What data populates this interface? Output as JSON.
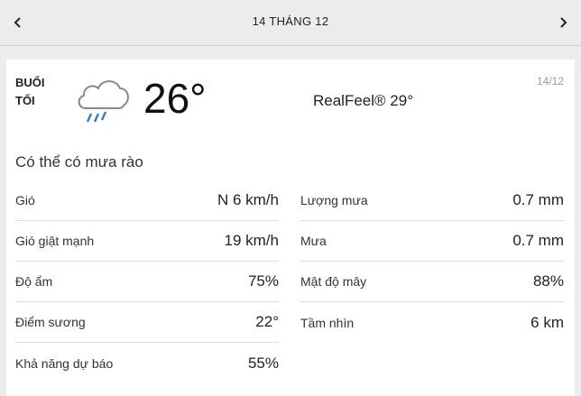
{
  "header": {
    "title": "14 THÁNG 12",
    "prev_icon": "chevron-left-icon",
    "next_icon": "chevron-right-icon"
  },
  "card": {
    "period_line1": "BUỔI",
    "period_line2": "TỐI",
    "icon": "cloud-rain-icon",
    "temperature": "26°",
    "realfeel": "RealFeel® 29°",
    "date": "14/12",
    "phrase": "Có thể có mưa rào"
  },
  "details_left": [
    {
      "label": "Gió",
      "value": "N 6 km/h"
    },
    {
      "label": "Gió giật mạnh",
      "value": "19 km/h"
    },
    {
      "label": "Độ ẩm",
      "value": "75%"
    },
    {
      "label": "Điểm sương",
      "value": "22°"
    },
    {
      "label": "Khả năng dự báo",
      "value": "55%"
    }
  ],
  "details_right": [
    {
      "label": "Lượng mưa",
      "value": "0.7 mm"
    },
    {
      "label": "Mưa",
      "value": "0.7 mm"
    },
    {
      "label": "Mật độ mây",
      "value": "88%"
    },
    {
      "label": "Tầm nhìn",
      "value": "6 km"
    }
  ],
  "colors": {
    "background": "#ececec",
    "card": "#ffffff",
    "rain": "#3d7fc4",
    "cloud_outline": "#8a8a8a"
  }
}
